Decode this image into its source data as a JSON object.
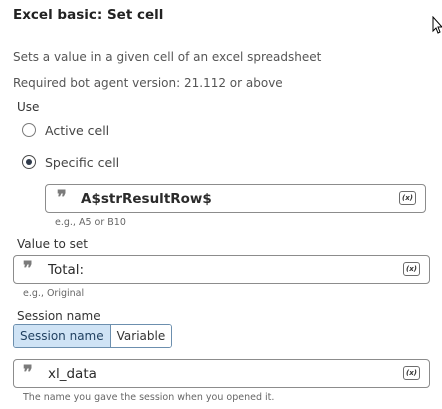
{
  "panel": {
    "title": "Excel basic: Set cell",
    "description": "Sets a value in a given cell of an excel spreadsheet",
    "requirement": "Required bot agent version: 21.112 or above"
  },
  "use": {
    "label": "Use",
    "options": [
      {
        "label": "Active cell",
        "selected": false
      },
      {
        "label": "Specific cell",
        "selected": true
      }
    ],
    "cell_value": "A$strResultRow$",
    "cell_hint": "e.g., A5 or B10"
  },
  "value_to_set": {
    "label": "Value to set",
    "value": "Total:",
    "hint": "e.g., Original"
  },
  "session": {
    "label": "Session name",
    "tabs": [
      {
        "label": "Session name",
        "active": true
      },
      {
        "label": "Variable",
        "active": false
      }
    ],
    "value": "xl_data",
    "hint": "The name you gave the session when you opened it."
  },
  "icons": {
    "quote": "quote-icon",
    "variable": "variable-insert-icon",
    "cursor": "mouse-cursor-icon"
  },
  "variable_button_label": "(x)",
  "quote_glyph": "❞"
}
